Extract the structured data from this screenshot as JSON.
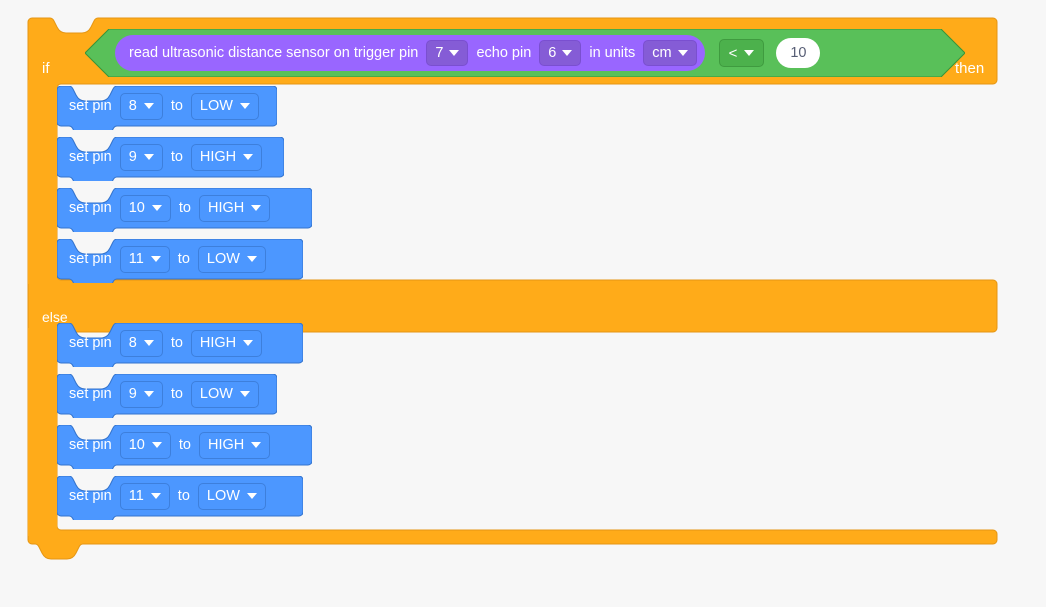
{
  "canvas": {
    "background": "#f7f7f7"
  },
  "palette": {
    "control_orange": "#ffab19",
    "control_orange_border": "#e59614",
    "operator_green": "#59c059",
    "operator_green_border": "#389438",
    "sensing_purple": "#9966ff",
    "sensing_purple_field": "#855cd6",
    "motion_blue": "#4c97ff",
    "motion_blue_field": "#4c97ff",
    "motion_blue_border": "#3373cc",
    "number_field_bg": "#ffffff",
    "number_field_text": "#575e75"
  },
  "script": {
    "control_block": {
      "type": "if-else",
      "if_label": "if",
      "then_label": "then",
      "else_label": "else"
    },
    "condition": {
      "type": "less-than-operator",
      "operator_value": "<",
      "operator_icon": "chevron-down-icon",
      "right_operand": "10",
      "left_operand": {
        "type": "ultrasonic-sensor-reporter",
        "text_1": "read ultrasonic distance sensor on trigger pin",
        "trigger_pin": "7",
        "text_2": "echo pin",
        "echo_pin": "6",
        "text_3": "in units",
        "units": "cm",
        "dropdown_icon": "chevron-down-icon"
      }
    },
    "if_branch": [
      {
        "prefix": "set pin",
        "pin": "8",
        "middle": "to",
        "state": "LOW",
        "dropdown_icon": "chevron-down-icon"
      },
      {
        "prefix": "set pin",
        "pin": "9",
        "middle": "to",
        "state": "HIGH",
        "dropdown_icon": "chevron-down-icon"
      },
      {
        "prefix": "set pin",
        "pin": "10",
        "middle": "to",
        "state": "HIGH",
        "dropdown_icon": "chevron-down-icon"
      },
      {
        "prefix": "set pin",
        "pin": "11",
        "middle": "to",
        "state": "LOW",
        "dropdown_icon": "chevron-down-icon"
      }
    ],
    "else_branch": [
      {
        "prefix": "set pin",
        "pin": "8",
        "middle": "to",
        "state": "HIGH",
        "dropdown_icon": "chevron-down-icon"
      },
      {
        "prefix": "set pin",
        "pin": "9",
        "middle": "to",
        "state": "LOW",
        "dropdown_icon": "chevron-down-icon"
      },
      {
        "prefix": "set pin",
        "pin": "10",
        "middle": "to",
        "state": "HIGH",
        "dropdown_icon": "chevron-down-icon"
      },
      {
        "prefix": "set pin",
        "pin": "11",
        "middle": "to",
        "state": "LOW",
        "dropdown_icon": "chevron-down-icon"
      }
    ]
  }
}
